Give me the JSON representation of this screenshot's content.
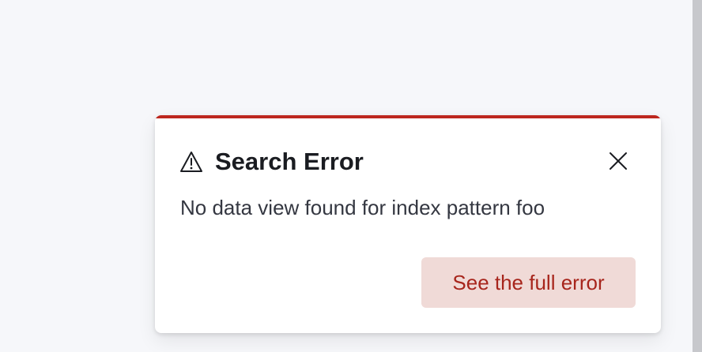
{
  "toast": {
    "icon": "warning-triangle-icon",
    "title": "Search Error",
    "message": "No data view found for index pattern foo",
    "action_label": "See the full error",
    "close_icon": "close-icon"
  },
  "colors": {
    "accent": "#bd271e",
    "action_bg": "#f0dad7",
    "action_text": "#a7251c",
    "page_bg": "#f6f7fa"
  }
}
